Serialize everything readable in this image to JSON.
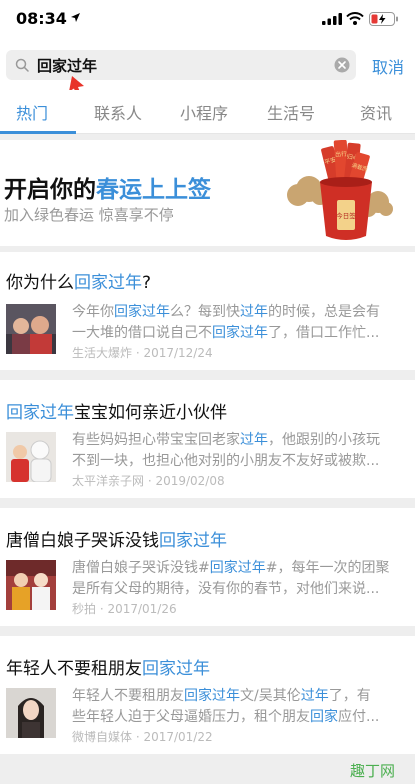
{
  "status_bar": {
    "time": "08:34"
  },
  "search": {
    "query": "回家过年",
    "cancel": "取消"
  },
  "tabs": [
    {
      "label": "热门",
      "active": true
    },
    {
      "label": "联系人"
    },
    {
      "label": "小程序"
    },
    {
      "label": "生活号"
    },
    {
      "label": "资讯"
    }
  ],
  "banner": {
    "title_pre": "开启你的",
    "title_hl": "春运上上签",
    "subtitle": "加入绿色春运 惊喜享不停",
    "art_text": [
      "平安",
      "出行",
      "归心",
      "满载而",
      "今日签"
    ]
  },
  "results": [
    {
      "title_pre": "你为什么",
      "title_hl": "回家过年",
      "title_post": "?",
      "excerpt_l1_a": "今年你",
      "excerpt_l1_hl1": "回家过年",
      "excerpt_l1_b": "么？每到快",
      "excerpt_l1_hl2": "过年",
      "excerpt_l1_c": "的时候，总是会有",
      "excerpt_l2_a": "一大堆的借口说自己不",
      "excerpt_l2_hl": "回家过年",
      "excerpt_l2_b": "了，借口工作忙...",
      "meta": "生活大爆炸 · 2017/12/24"
    },
    {
      "title_pre": "",
      "title_hl": "回家过年",
      "title_post": "宝宝如何亲近小伙伴",
      "excerpt_l1_a": "有些妈妈担心带宝宝回老家",
      "excerpt_l1_hl": "过年",
      "excerpt_l1_b": "，他跟别的小孩玩",
      "excerpt_l2": "不到一块，也担心他对别的小朋友不友好或被欺...",
      "meta": "太平洋亲子网 · 2019/02/08"
    },
    {
      "title_pre": "唐僧白娘子哭诉没钱",
      "title_hl": "回家过年",
      "title_post": "",
      "excerpt_l1_a": "唐僧白娘子哭诉没钱#",
      "excerpt_l1_hl": "回家过年",
      "excerpt_l1_b": "#，每年一次的团聚",
      "excerpt_l2": "是所有父母的期待，没有你的春节，对他们来说...",
      "meta": "秒拍 · 2017/01/26"
    },
    {
      "title_pre": "年轻人不要租朋友",
      "title_hl": "回家过年",
      "title_post": "",
      "excerpt_l1_a": "年轻人不要租朋友",
      "excerpt_l1_hl1": "回家过年",
      "excerpt_l1_b": "文/吴其伦",
      "excerpt_l1_hl2": "过年",
      "excerpt_l1_c": "了，有",
      "excerpt_l2_a": "些年轻人迫于父母逼婚压力，租个朋友",
      "excerpt_l2_hl": "回家",
      "excerpt_l2_b": "应付...",
      "meta": "微博自媒体 · 2017/01/22"
    }
  ],
  "watermark": "趣丁网",
  "colors": {
    "accent": "#3b8fd9",
    "annotation_arrow": "#e8332a"
  }
}
